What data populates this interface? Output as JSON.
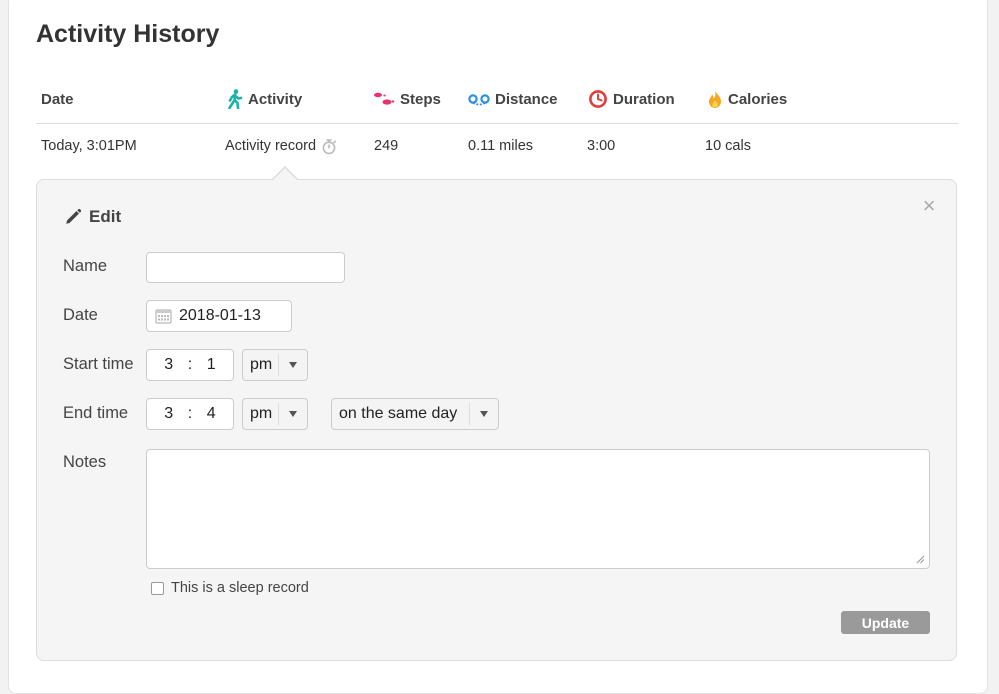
{
  "page": {
    "title": "Activity History"
  },
  "table": {
    "headers": {
      "date": "Date",
      "activity": "Activity",
      "steps": "Steps",
      "distance": "Distance",
      "duration": "Duration",
      "calories": "Calories"
    },
    "header_icons": {
      "activity": "walker-icon",
      "steps": "footprints-icon",
      "distance": "route-icon",
      "duration": "clock-icon",
      "calories": "flame-icon"
    },
    "row": {
      "date": "Today, 3:01PM",
      "activity": "Activity record",
      "activity_icon": "stopwatch-icon",
      "steps": "249",
      "distance": "0.11 miles",
      "duration": "3:00",
      "calories": "10 cals"
    }
  },
  "edit": {
    "title": "Edit",
    "labels": {
      "name": "Name",
      "date": "Date",
      "start_time": "Start time",
      "end_time": "End time",
      "notes": "Notes"
    },
    "name_value": "",
    "date_value": "2018-01-13",
    "start": {
      "hour": "3",
      "sep": ":",
      "minute": "1",
      "ampm": "pm"
    },
    "end": {
      "hour": "3",
      "sep": ":",
      "minute": "4",
      "ampm": "pm",
      "day": "on the same day"
    },
    "notes_value": "",
    "sleep_label": "This is a sleep record",
    "update_label": "Update",
    "close_glyph": "×"
  },
  "colors": {
    "activity": "#1ab3a8",
    "steps": "#e8336e",
    "distance": "#2d8fe6",
    "duration": "#e23c3c",
    "calories": "#f5a623",
    "button": "#9a9a9a"
  }
}
